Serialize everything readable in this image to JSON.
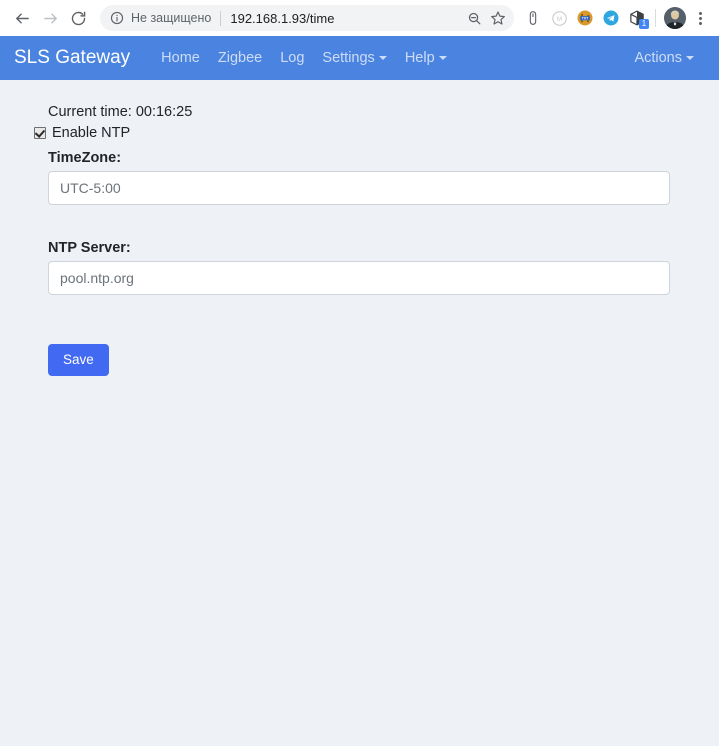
{
  "browser": {
    "back_icon": "back-arrow-icon",
    "forward_icon": "forward-arrow-icon",
    "reload_icon": "reload-icon",
    "info_icon": "info-circle-icon",
    "security_text": "Не защищено",
    "url": "192.168.1.93/time",
    "zoom_out_icon": "zoom-out-magnifier-icon",
    "bookmark_icon": "star-bookmark-icon",
    "extensions": [
      {
        "name": "mouse-extension-icon",
        "badge": ""
      },
      {
        "name": "metamask-extension-icon",
        "badge": ""
      },
      {
        "name": "cookie-txt-extension-icon",
        "badge": ""
      },
      {
        "name": "telegram-extension-icon",
        "badge": ""
      },
      {
        "name": "box-extension-icon",
        "badge": "1"
      }
    ],
    "avatar_label": "profile-avatar",
    "menu_label": "chrome-menu-icon"
  },
  "navbar": {
    "brand": "SLS Gateway",
    "links": [
      {
        "label": "Home",
        "caret": false
      },
      {
        "label": "Zigbee",
        "caret": false
      },
      {
        "label": "Log",
        "caret": false
      },
      {
        "label": "Settings",
        "caret": true
      },
      {
        "label": "Help",
        "caret": true
      }
    ],
    "actions": {
      "label": "Actions",
      "caret": true
    },
    "bg_color": "#4a83e0"
  },
  "page": {
    "current_time": "Current time: 00:16:25",
    "enable_ntp": {
      "label": "Enable NTP",
      "checked": true
    },
    "timezone": {
      "label": "TimeZone:",
      "value": "UTC-5:00",
      "placeholder": "UTC-5:00"
    },
    "ntp_server": {
      "label": "NTP Server:",
      "value": "pool.ntp.org",
      "placeholder": "pool.ntp.org"
    },
    "save_label": "Save",
    "save_color": "#4269f1",
    "bg_color": "#eef2f7"
  }
}
